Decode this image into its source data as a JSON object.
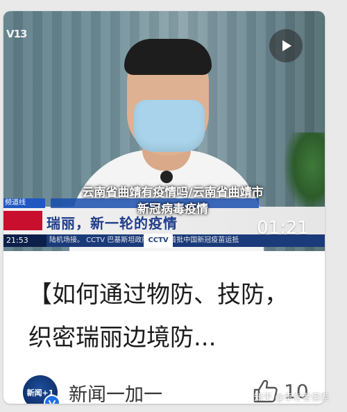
{
  "video": {
    "channel_logo": "V13",
    "side_tag_top": "频道线",
    "headline_strip": "瑞丽，新一轮的疫情",
    "ticker_time": "21:53",
    "ticker_text": "陆机场接。   CCTV  巴基斯坦政府采购的首批中国新冠疫苗运抵",
    "cctv_badge": "CCTV",
    "duration": "01:21",
    "overlay_title_line1": "云南省曲靖有疫情吗/云南省曲靖市",
    "overlay_title_line2": "新冠病毒疫情",
    "play_icon": "play-icon"
  },
  "article": {
    "quote": "【如何通过物防、技防，织密瑞丽边境防..."
  },
  "account": {
    "avatar_text": "新闻+1",
    "name": "新闻一加一",
    "verified_icon": "verified-icon"
  },
  "like": {
    "icon": "thumbs-up-icon",
    "count": "10"
  },
  "watermark": "知乎 @幸存者偏差",
  "colors": {
    "tv_blue": "#1a3a7a",
    "tv_red": "#c8102e",
    "verified_blue": "#1f6fe5"
  }
}
